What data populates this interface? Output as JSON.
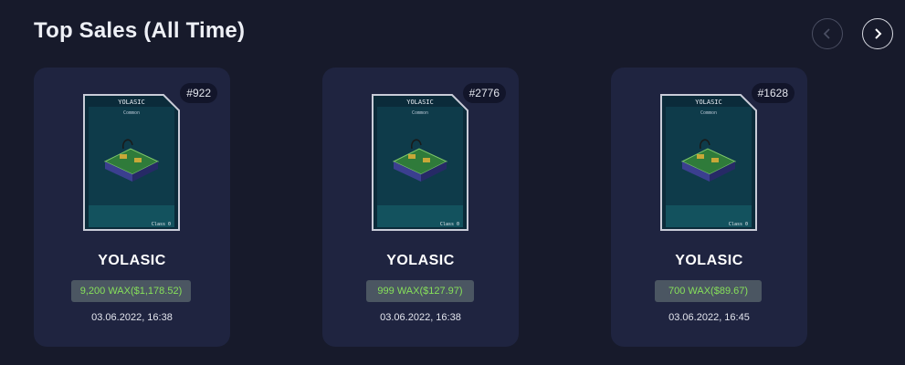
{
  "page": {
    "title": "Top Sales (All Time)"
  },
  "navigation": {
    "prev_icon": "chevron-left-icon",
    "next_icon": "chevron-right-icon"
  },
  "cards": [
    {
      "serial": "#922",
      "name": "YOLASIC",
      "price": "9,200 WAX($1,178.52)",
      "date": "03.06.2022, 16:38",
      "nft": {
        "title": "YOLASIC",
        "rarity": "Common",
        "class": "Class 0"
      }
    },
    {
      "serial": "#2776",
      "name": "YOLASIC",
      "price": "999 WAX($127.97)",
      "date": "03.06.2022, 16:38",
      "nft": {
        "title": "YOLASIC",
        "rarity": "Common",
        "class": "Class 0"
      }
    },
    {
      "serial": "#1628",
      "name": "YOLASIC",
      "price": "700 WAX($89.67)",
      "date": "03.06.2022, 16:45",
      "nft": {
        "title": "YOLASIC",
        "rarity": "Common",
        "class": "Class 0"
      }
    }
  ],
  "colors": {
    "background": "#171a2b",
    "card": "#1f2440",
    "price_text": "#86e05a",
    "price_bg": "#4b5662"
  }
}
